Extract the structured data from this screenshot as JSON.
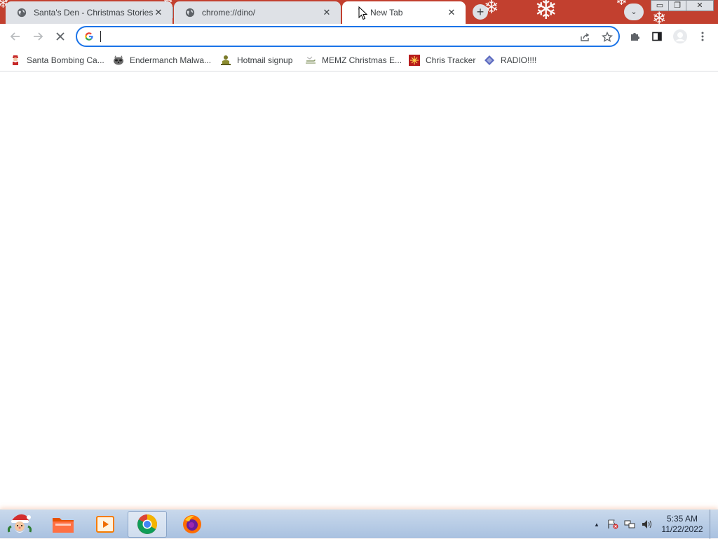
{
  "window": {
    "tabs": [
      {
        "title": "Santa's Den - Christmas Stories and more",
        "active": false,
        "favicon": "globe-icon"
      },
      {
        "title": "chrome://dino/",
        "active": false,
        "favicon": "globe-icon"
      },
      {
        "title": "New Tab",
        "active": true,
        "favicon": "loading-spinner-icon"
      }
    ],
    "tab_close_glyph": "✕",
    "new_tab_glyph": "+",
    "tab_search_glyph": "⌄",
    "controls": {
      "minimize": "▭",
      "maximize": "❐",
      "close": "✕"
    },
    "accent_color": "#c2402f"
  },
  "toolbar": {
    "back_icon": "arrow-left-icon",
    "forward_icon": "arrow-right-icon",
    "stop_icon": "close-icon",
    "omnibox": {
      "value": "",
      "placeholder": "",
      "focus_color": "#1a73e8"
    },
    "share_icon": "share-icon",
    "bookmark_icon": "star-icon",
    "extensions_icon": "puzzle-icon",
    "side_panel_icon": "side-panel-icon",
    "profile_icon": "avatar-icon",
    "menu_icon": "kebab-menu-icon"
  },
  "bookmarks": [
    {
      "label": "Santa Bombing Ca...",
      "icon": "santa-icon"
    },
    {
      "label": "Endermanch Malwa...",
      "icon": "raccoon-icon"
    },
    {
      "label": "Hotmail signup",
      "icon": "person-icon"
    },
    {
      "label": "MEMZ Christmas E...",
      "icon": "sleigh-icon"
    },
    {
      "label": "Chris Tracker",
      "icon": "snowflake-icon"
    },
    {
      "label": "RADIO!!!!",
      "icon": "diamond-icon"
    }
  ],
  "taskbar": {
    "apps": [
      {
        "name": "start",
        "icon": "santa-start-icon"
      },
      {
        "name": "file-explorer",
        "icon": "folder-icon"
      },
      {
        "name": "media-player",
        "icon": "media-player-icon"
      },
      {
        "name": "chrome",
        "icon": "chrome-icon",
        "active": true
      },
      {
        "name": "firefox",
        "icon": "firefox-icon"
      }
    ],
    "tray": {
      "up_arrow": "▲",
      "time": "5:35 AM",
      "date": "11/22/2022"
    }
  }
}
